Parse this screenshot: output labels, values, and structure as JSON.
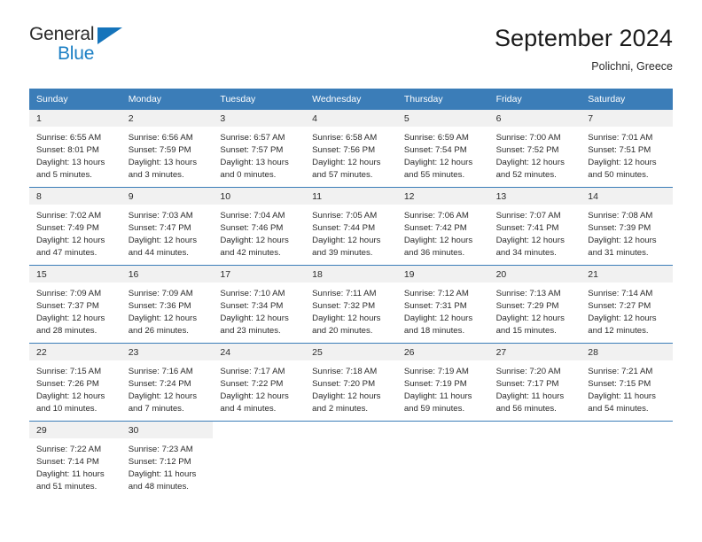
{
  "brand": {
    "name_top": "General",
    "name_bottom": "Blue",
    "triangle_color": "#1574bb"
  },
  "header": {
    "title": "September 2024",
    "subtitle": "Polichni, Greece"
  },
  "theme": {
    "header_blue": "#3b7db8",
    "day_band_gray": "#f1f1f1",
    "text_color": "#2b2b2b"
  },
  "calendar": {
    "weekdays": [
      "Sunday",
      "Monday",
      "Tuesday",
      "Wednesday",
      "Thursday",
      "Friday",
      "Saturday"
    ],
    "weeks": [
      [
        {
          "day": "1",
          "sunrise": "Sunrise: 6:55 AM",
          "sunset": "Sunset: 8:01 PM",
          "daylight_1": "Daylight: 13 hours",
          "daylight_2": "and 5 minutes."
        },
        {
          "day": "2",
          "sunrise": "Sunrise: 6:56 AM",
          "sunset": "Sunset: 7:59 PM",
          "daylight_1": "Daylight: 13 hours",
          "daylight_2": "and 3 minutes."
        },
        {
          "day": "3",
          "sunrise": "Sunrise: 6:57 AM",
          "sunset": "Sunset: 7:57 PM",
          "daylight_1": "Daylight: 13 hours",
          "daylight_2": "and 0 minutes."
        },
        {
          "day": "4",
          "sunrise": "Sunrise: 6:58 AM",
          "sunset": "Sunset: 7:56 PM",
          "daylight_1": "Daylight: 12 hours",
          "daylight_2": "and 57 minutes."
        },
        {
          "day": "5",
          "sunrise": "Sunrise: 6:59 AM",
          "sunset": "Sunset: 7:54 PM",
          "daylight_1": "Daylight: 12 hours",
          "daylight_2": "and 55 minutes."
        },
        {
          "day": "6",
          "sunrise": "Sunrise: 7:00 AM",
          "sunset": "Sunset: 7:52 PM",
          "daylight_1": "Daylight: 12 hours",
          "daylight_2": "and 52 minutes."
        },
        {
          "day": "7",
          "sunrise": "Sunrise: 7:01 AM",
          "sunset": "Sunset: 7:51 PM",
          "daylight_1": "Daylight: 12 hours",
          "daylight_2": "and 50 minutes."
        }
      ],
      [
        {
          "day": "8",
          "sunrise": "Sunrise: 7:02 AM",
          "sunset": "Sunset: 7:49 PM",
          "daylight_1": "Daylight: 12 hours",
          "daylight_2": "and 47 minutes."
        },
        {
          "day": "9",
          "sunrise": "Sunrise: 7:03 AM",
          "sunset": "Sunset: 7:47 PM",
          "daylight_1": "Daylight: 12 hours",
          "daylight_2": "and 44 minutes."
        },
        {
          "day": "10",
          "sunrise": "Sunrise: 7:04 AM",
          "sunset": "Sunset: 7:46 PM",
          "daylight_1": "Daylight: 12 hours",
          "daylight_2": "and 42 minutes."
        },
        {
          "day": "11",
          "sunrise": "Sunrise: 7:05 AM",
          "sunset": "Sunset: 7:44 PM",
          "daylight_1": "Daylight: 12 hours",
          "daylight_2": "and 39 minutes."
        },
        {
          "day": "12",
          "sunrise": "Sunrise: 7:06 AM",
          "sunset": "Sunset: 7:42 PM",
          "daylight_1": "Daylight: 12 hours",
          "daylight_2": "and 36 minutes."
        },
        {
          "day": "13",
          "sunrise": "Sunrise: 7:07 AM",
          "sunset": "Sunset: 7:41 PM",
          "daylight_1": "Daylight: 12 hours",
          "daylight_2": "and 34 minutes."
        },
        {
          "day": "14",
          "sunrise": "Sunrise: 7:08 AM",
          "sunset": "Sunset: 7:39 PM",
          "daylight_1": "Daylight: 12 hours",
          "daylight_2": "and 31 minutes."
        }
      ],
      [
        {
          "day": "15",
          "sunrise": "Sunrise: 7:09 AM",
          "sunset": "Sunset: 7:37 PM",
          "daylight_1": "Daylight: 12 hours",
          "daylight_2": "and 28 minutes."
        },
        {
          "day": "16",
          "sunrise": "Sunrise: 7:09 AM",
          "sunset": "Sunset: 7:36 PM",
          "daylight_1": "Daylight: 12 hours",
          "daylight_2": "and 26 minutes."
        },
        {
          "day": "17",
          "sunrise": "Sunrise: 7:10 AM",
          "sunset": "Sunset: 7:34 PM",
          "daylight_1": "Daylight: 12 hours",
          "daylight_2": "and 23 minutes."
        },
        {
          "day": "18",
          "sunrise": "Sunrise: 7:11 AM",
          "sunset": "Sunset: 7:32 PM",
          "daylight_1": "Daylight: 12 hours",
          "daylight_2": "and 20 minutes."
        },
        {
          "day": "19",
          "sunrise": "Sunrise: 7:12 AM",
          "sunset": "Sunset: 7:31 PM",
          "daylight_1": "Daylight: 12 hours",
          "daylight_2": "and 18 minutes."
        },
        {
          "day": "20",
          "sunrise": "Sunrise: 7:13 AM",
          "sunset": "Sunset: 7:29 PM",
          "daylight_1": "Daylight: 12 hours",
          "daylight_2": "and 15 minutes."
        },
        {
          "day": "21",
          "sunrise": "Sunrise: 7:14 AM",
          "sunset": "Sunset: 7:27 PM",
          "daylight_1": "Daylight: 12 hours",
          "daylight_2": "and 12 minutes."
        }
      ],
      [
        {
          "day": "22",
          "sunrise": "Sunrise: 7:15 AM",
          "sunset": "Sunset: 7:26 PM",
          "daylight_1": "Daylight: 12 hours",
          "daylight_2": "and 10 minutes."
        },
        {
          "day": "23",
          "sunrise": "Sunrise: 7:16 AM",
          "sunset": "Sunset: 7:24 PM",
          "daylight_1": "Daylight: 12 hours",
          "daylight_2": "and 7 minutes."
        },
        {
          "day": "24",
          "sunrise": "Sunrise: 7:17 AM",
          "sunset": "Sunset: 7:22 PM",
          "daylight_1": "Daylight: 12 hours",
          "daylight_2": "and 4 minutes."
        },
        {
          "day": "25",
          "sunrise": "Sunrise: 7:18 AM",
          "sunset": "Sunset: 7:20 PM",
          "daylight_1": "Daylight: 12 hours",
          "daylight_2": "and 2 minutes."
        },
        {
          "day": "26",
          "sunrise": "Sunrise: 7:19 AM",
          "sunset": "Sunset: 7:19 PM",
          "daylight_1": "Daylight: 11 hours",
          "daylight_2": "and 59 minutes."
        },
        {
          "day": "27",
          "sunrise": "Sunrise: 7:20 AM",
          "sunset": "Sunset: 7:17 PM",
          "daylight_1": "Daylight: 11 hours",
          "daylight_2": "and 56 minutes."
        },
        {
          "day": "28",
          "sunrise": "Sunrise: 7:21 AM",
          "sunset": "Sunset: 7:15 PM",
          "daylight_1": "Daylight: 11 hours",
          "daylight_2": "and 54 minutes."
        }
      ],
      [
        {
          "day": "29",
          "sunrise": "Sunrise: 7:22 AM",
          "sunset": "Sunset: 7:14 PM",
          "daylight_1": "Daylight: 11 hours",
          "daylight_2": "and 51 minutes."
        },
        {
          "day": "30",
          "sunrise": "Sunrise: 7:23 AM",
          "sunset": "Sunset: 7:12 PM",
          "daylight_1": "Daylight: 11 hours",
          "daylight_2": "and 48 minutes."
        },
        {
          "day": "",
          "sunrise": "",
          "sunset": "",
          "daylight_1": "",
          "daylight_2": ""
        },
        {
          "day": "",
          "sunrise": "",
          "sunset": "",
          "daylight_1": "",
          "daylight_2": ""
        },
        {
          "day": "",
          "sunrise": "",
          "sunset": "",
          "daylight_1": "",
          "daylight_2": ""
        },
        {
          "day": "",
          "sunrise": "",
          "sunset": "",
          "daylight_1": "",
          "daylight_2": ""
        },
        {
          "day": "",
          "sunrise": "",
          "sunset": "",
          "daylight_1": "",
          "daylight_2": ""
        }
      ]
    ]
  }
}
